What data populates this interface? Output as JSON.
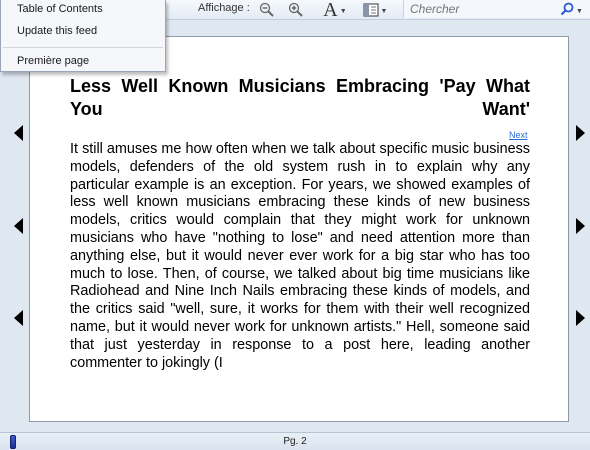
{
  "menu": {
    "items": [
      {
        "label": "Table of Contents"
      },
      {
        "label": "Update this feed"
      },
      {
        "label": "Première page"
      }
    ]
  },
  "toolbar": {
    "affichage_label": "Affichage :",
    "search_placeholder": "Chercher",
    "font_glyph": "A"
  },
  "article": {
    "title": "Less Well Known Musicians Embracing 'Pay What You Want'",
    "next_link": "Next",
    "body": "It still amuses me how often when we talk about specific music business models, defenders of the old system rush in to explain why any particular example is an exception. For years, we showed examples of less well known musicians embracing these kinds of new business models, critics would complain that they might work for unknown musicians who have \"nothing to lose\" and need attention more than anything else, but it would never ever work for a big star who has too much to lose. Then, of course, we talked about big time musicians like Radiohead and Nine Inch Nails embracing these kinds of models, and the critics said \"well, sure, it works for them with their well recognized name, but it would never work for unknown artists.\" Hell, someone said that just yesterday in response to a post here, leading another commenter to jokingly (I"
  },
  "status": {
    "page_indicator": "Pg. 2"
  },
  "icons": {
    "zoom_out": "zoom-out-icon",
    "zoom_in": "zoom-in-icon",
    "font_size": "font-size-icon",
    "layout": "page-layout-icon",
    "search": "search-icon",
    "prev": "prev-page-arrow",
    "next": "next-page-arrow"
  },
  "colors": {
    "accent": "#2a6ad8",
    "window_bg": "#dfe7f1",
    "progress": "#2a3fb0"
  }
}
